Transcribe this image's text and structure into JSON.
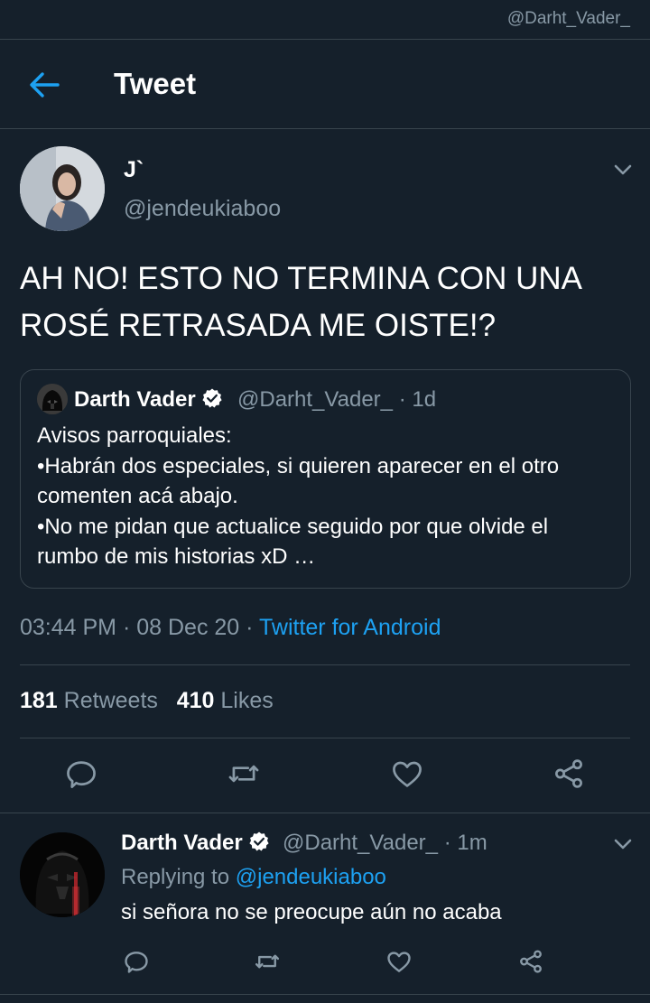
{
  "topbar": {
    "handle": "@Darht_Vader_"
  },
  "header": {
    "title": "Tweet"
  },
  "tweet": {
    "name": "J`",
    "handle": "@jendeukiaboo",
    "text": "AH NO! ESTO NO TERMINA CON UNA ROSÉ RETRASADA ME OISTE!?",
    "time": "03:44 PM",
    "date": "08 Dec 20",
    "source": "Twitter for Android",
    "retweets_count": "181",
    "retweets_label": "Retweets",
    "likes_count": "410",
    "likes_label": "Likes"
  },
  "quote": {
    "name": "Darth Vader",
    "handle": "@Darht_Vader_",
    "age": "1d",
    "text": "Avisos parroquiales:\n•Habrán dos especiales, si quieren aparecer en el otro comenten acá abajo.\n•No me pidan que actualice seguido por que olvide el rumbo de mis historias xD …"
  },
  "reply": {
    "name": "Darth Vader",
    "handle": "@Darht_Vader_",
    "age": "1m",
    "replying_prefix": "Replying to",
    "replying_to": "@jendeukiaboo",
    "text": "si señora no se preocupe aún no acaba"
  },
  "colors": {
    "background": "#15202b",
    "accent": "#1da1f2",
    "muted": "#8899a6",
    "divider": "#38444d"
  },
  "icons": [
    "back-arrow-icon",
    "chevron-down-icon",
    "verified-icon",
    "reply-icon",
    "retweet-icon",
    "like-icon",
    "share-icon"
  ]
}
